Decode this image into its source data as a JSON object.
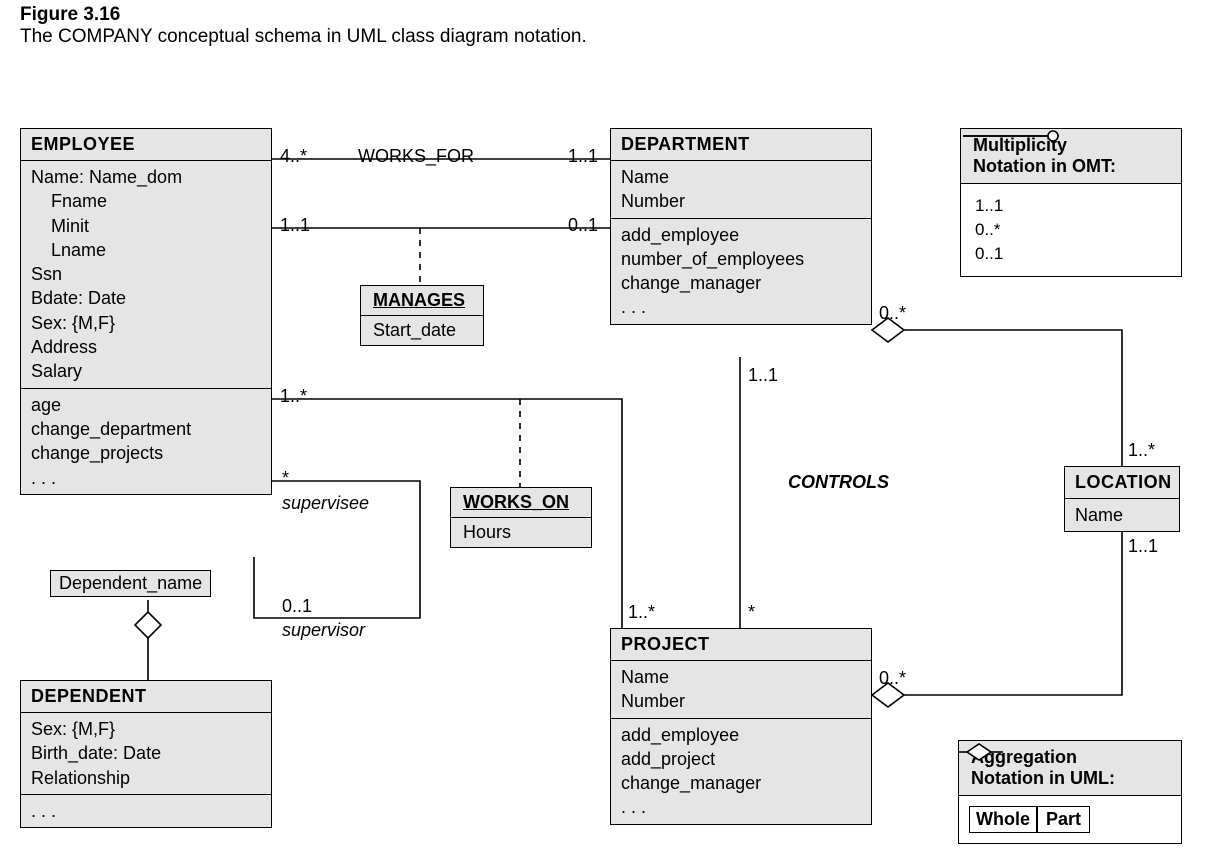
{
  "figure": {
    "num": "Figure 3.16",
    "caption": "The COMPANY conceptual schema in UML class diagram notation."
  },
  "employee": {
    "title": "EMPLOYEE",
    "attrs": [
      "Name: Name_dom",
      "    Fname",
      "    Minit",
      "    Lname",
      "Ssn",
      "Bdate: Date",
      "Sex: {M,F}",
      "Address",
      "Salary"
    ],
    "ops": [
      "age",
      "change_department",
      "change_projects",
      ". . ."
    ]
  },
  "department": {
    "title": "DEPARTMENT",
    "attrs": [
      "Name",
      "Number"
    ],
    "ops": [
      "add_employee",
      "number_of_employees",
      "change_manager",
      ". . ."
    ]
  },
  "project": {
    "title": "PROJECT",
    "attrs": [
      "Name",
      "Number"
    ],
    "ops": [
      "add_employee",
      "add_project",
      "change_manager",
      ". . ."
    ]
  },
  "dependent": {
    "title": "DEPENDENT",
    "attrs": [
      "Sex: {M,F}",
      "Birth_date: Date",
      "Relationship"
    ],
    "ops": [
      ". . ."
    ]
  },
  "location": {
    "title": "LOCATION",
    "attr": "Name"
  },
  "manages": {
    "title": "MANAGES",
    "attr": "Start_date"
  },
  "workson": {
    "title": "WORKS_ON",
    "attr": "Hours"
  },
  "qualifier": "Dependent_name",
  "assoc": {
    "works_for": {
      "name": "WORKS_FOR",
      "left": "4..*",
      "right": "1..1"
    },
    "manages": {
      "left": "1..1",
      "right": "0..1"
    },
    "controls": {
      "name": "CONTROLS",
      "top": "1..1",
      "bottom": "1..*"
    },
    "works_on": {
      "left": "1..*",
      "right": "*"
    },
    "supervision": {
      "sup_role": "supervisor",
      "sub_role": "supervisee",
      "star": "*",
      "zerone": "0..1"
    },
    "dept_loc": {
      "dept": "0..*",
      "loc": "1..*"
    },
    "proj_loc": {
      "proj": "0..*",
      "loc": "1..1"
    }
  },
  "legend_omt": {
    "title1": "Multiplicity",
    "title2": "Notation in OMT:",
    "r1": "1..1",
    "r2": "0..*",
    "r3": "0..1"
  },
  "legend_agg": {
    "title1": "Aggregation",
    "title2": "Notation in UML:",
    "whole": "Whole",
    "part": "Part"
  }
}
